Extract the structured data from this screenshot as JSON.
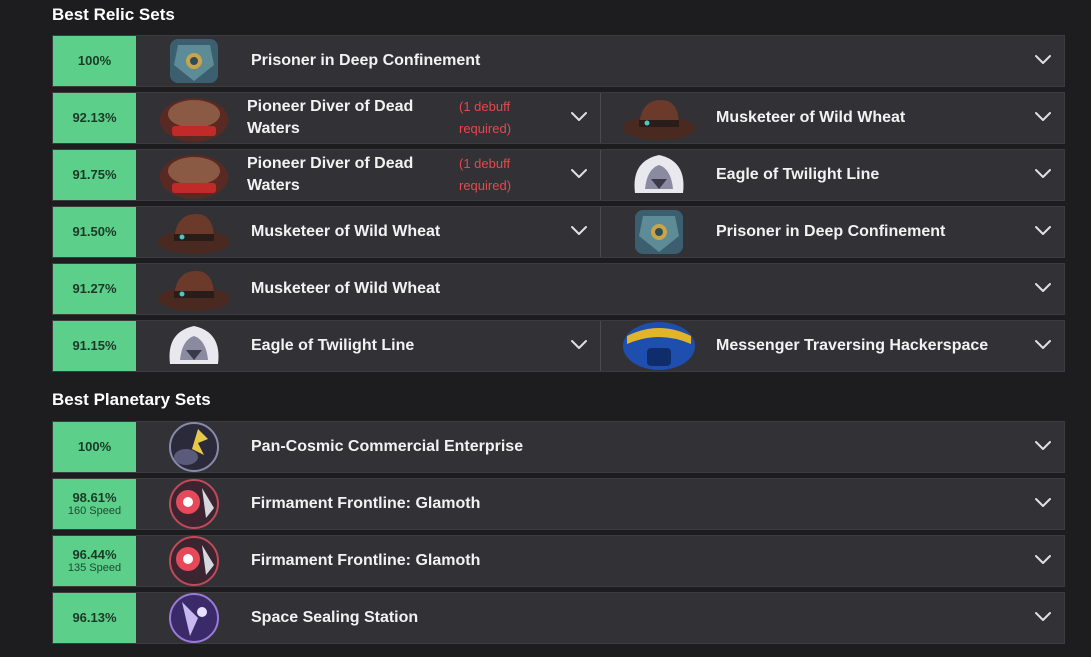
{
  "relic_section": {
    "title": "Best Relic Sets",
    "rows": [
      {
        "pct": "100%",
        "sets": [
          {
            "name": "Prisoner in Deep Confinement",
            "icon": "prisoner-relic-icon"
          }
        ]
      },
      {
        "pct": "92.13%",
        "sets": [
          {
            "name": "Pioneer Diver of Dead Waters",
            "note": "(1 debuff required)",
            "icon": "pioneer-relic-icon"
          },
          {
            "name": "Musketeer of Wild Wheat",
            "icon": "musketeer-relic-icon"
          }
        ]
      },
      {
        "pct": "91.75%",
        "sets": [
          {
            "name": "Pioneer Diver of Dead Waters",
            "note": "(1 debuff required)",
            "icon": "pioneer-relic-icon"
          },
          {
            "name": "Eagle of Twilight Line",
            "icon": "eagle-relic-icon"
          }
        ]
      },
      {
        "pct": "91.50%",
        "sets": [
          {
            "name": "Musketeer of Wild Wheat",
            "icon": "musketeer-relic-icon"
          },
          {
            "name": "Prisoner in Deep Confinement",
            "icon": "prisoner-relic-icon"
          }
        ]
      },
      {
        "pct": "91.27%",
        "sets": [
          {
            "name": "Musketeer of Wild Wheat",
            "icon": "musketeer-relic-icon"
          }
        ]
      },
      {
        "pct": "91.15%",
        "sets": [
          {
            "name": "Eagle of Twilight Line",
            "icon": "eagle-relic-icon"
          },
          {
            "name": "Messenger Traversing Hackerspace",
            "icon": "messenger-relic-icon"
          }
        ]
      }
    ]
  },
  "planar_section": {
    "title": "Best Planetary Sets",
    "rows": [
      {
        "pct": "100%",
        "sets": [
          {
            "name": "Pan-Cosmic Commercial Enterprise",
            "icon": "pan-cosmic-planar-icon"
          }
        ]
      },
      {
        "pct": "98.61%",
        "sub": "160 Speed",
        "sets": [
          {
            "name": "Firmament Frontline: Glamoth",
            "icon": "glamoth-planar-icon"
          }
        ]
      },
      {
        "pct": "96.44%",
        "sub": "135 Speed",
        "sets": [
          {
            "name": "Firmament Frontline: Glamoth",
            "icon": "glamoth-planar-icon"
          }
        ]
      },
      {
        "pct": "96.13%",
        "sets": [
          {
            "name": "Space Sealing Station",
            "icon": "space-sealing-planar-icon"
          }
        ]
      }
    ]
  },
  "colors": {
    "background": "#1d1d1f",
    "row_bg": "#323236",
    "pct_bg": "#5ccf8a",
    "note": "#e5484d"
  }
}
